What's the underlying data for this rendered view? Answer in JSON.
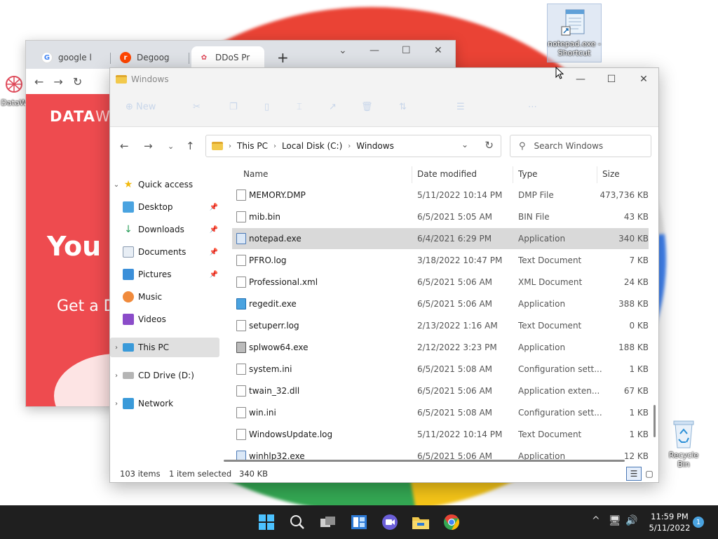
{
  "desktop": {
    "icons": {
      "notepad_shortcut": "notepad.exe - Shortcut",
      "recycle_bin": "Recycle Bin",
      "dataw": "DataW"
    }
  },
  "browser": {
    "tabs": [
      {
        "label": "google l",
        "favicon": "G"
      },
      {
        "label": "Degoog",
        "favicon": "r"
      },
      {
        "label": "DDoS Pr",
        "favicon": "✿"
      }
    ],
    "page": {
      "logo_main": "DATA",
      "logo_rest": "W",
      "hero": "You I",
      "subtitle": "Get a D"
    },
    "brand_color": "#ee4b4f"
  },
  "explorer": {
    "title": "Windows",
    "command_bar": {
      "new_label": "New"
    },
    "address": {
      "crumbs": [
        "This PC",
        "Local Disk (C:)",
        "Windows"
      ]
    },
    "search_placeholder": "Search Windows",
    "sidebar": {
      "quick_access": "Quick access",
      "items": [
        "Desktop",
        "Downloads",
        "Documents",
        "Pictures",
        "Music",
        "Videos"
      ],
      "this_pc": "This PC",
      "cd_drive": "CD Drive (D:)",
      "network": "Network"
    },
    "columns": {
      "name": "Name",
      "date": "Date modified",
      "type": "Type",
      "size": "Size"
    },
    "files": [
      {
        "name": "MEMORY.DMP",
        "date": "5/11/2022 10:14 PM",
        "type": "DMP File",
        "size": "473,736 KB"
      },
      {
        "name": "mib.bin",
        "date": "6/5/2021 5:05 AM",
        "type": "BIN File",
        "size": "43 KB"
      },
      {
        "name": "notepad.exe",
        "date": "6/4/2021 6:29 PM",
        "type": "Application",
        "size": "340 KB"
      },
      {
        "name": "PFRO.log",
        "date": "3/18/2022 10:47 PM",
        "type": "Text Document",
        "size": "7 KB"
      },
      {
        "name": "Professional.xml",
        "date": "6/5/2021 5:06 AM",
        "type": "XML Document",
        "size": "24 KB"
      },
      {
        "name": "regedit.exe",
        "date": "6/5/2021 5:06 AM",
        "type": "Application",
        "size": "388 KB"
      },
      {
        "name": "setuperr.log",
        "date": "2/13/2022 1:16 AM",
        "type": "Text Document",
        "size": "0 KB"
      },
      {
        "name": "splwow64.exe",
        "date": "2/12/2022 3:23 PM",
        "type": "Application",
        "size": "188 KB"
      },
      {
        "name": "system.ini",
        "date": "6/5/2021 5:08 AM",
        "type": "Configuration sett...",
        "size": "1 KB"
      },
      {
        "name": "twain_32.dll",
        "date": "6/5/2021 5:06 AM",
        "type": "Application exten...",
        "size": "67 KB"
      },
      {
        "name": "win.ini",
        "date": "6/5/2021 5:08 AM",
        "type": "Configuration sett...",
        "size": "1 KB"
      },
      {
        "name": "WindowsUpdate.log",
        "date": "5/11/2022 10:14 PM",
        "type": "Text Document",
        "size": "1 KB"
      },
      {
        "name": "winhlp32.exe",
        "date": "6/5/2021 5:06 AM",
        "type": "Application",
        "size": "12 KB"
      }
    ],
    "selected_file": "notepad.exe",
    "status": {
      "items": "103 items",
      "selected": "1 item selected",
      "size": "340 KB"
    }
  },
  "taskbar": {
    "time": "11:59 PM",
    "date": "5/11/2022",
    "notifications": "1"
  }
}
